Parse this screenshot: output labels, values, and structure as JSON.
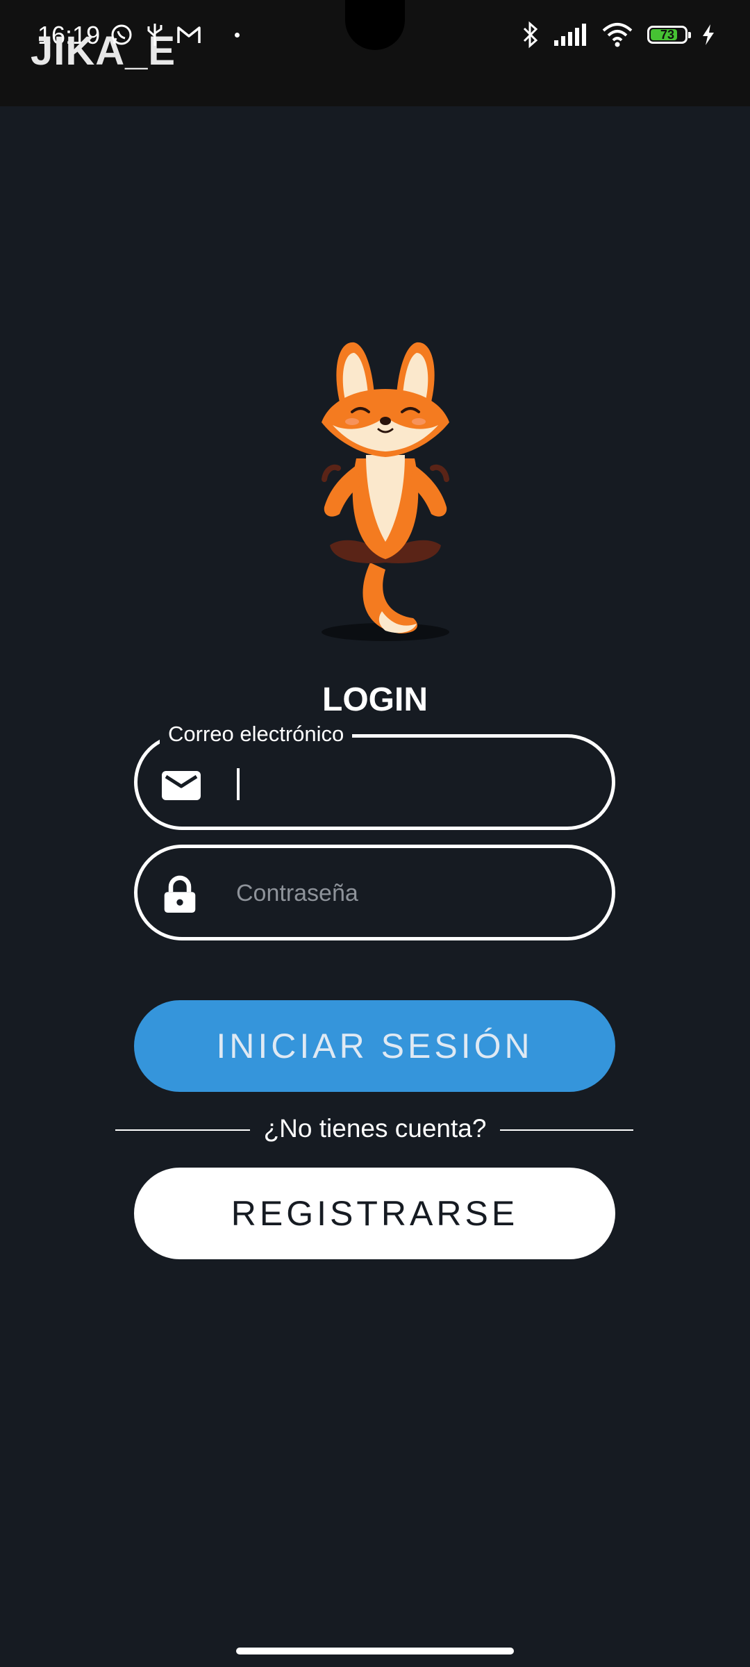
{
  "status_bar": {
    "time": "16:19",
    "app_overlay": "JIKA_E",
    "battery": "73",
    "icons": [
      "whatsapp-icon",
      "usb-icon",
      "gmail-icon",
      "bluetooth-icon",
      "signal-icon",
      "wifi-icon",
      "battery-icon",
      "charging-icon"
    ]
  },
  "login": {
    "title": "LOGIN",
    "email": {
      "label": "Correo electrónico",
      "value": "",
      "icon": "mail-icon"
    },
    "password": {
      "placeholder": "Contraseña",
      "value": "",
      "icon": "lock-icon"
    },
    "submit_label": "INICIAR SESIÓN",
    "no_account_text": "¿No tienes cuenta?",
    "register_label": "REGISTRARSE"
  },
  "colors": {
    "background": "#161b22",
    "primary_button": "#3595db",
    "secondary_button": "#ffffff",
    "battery_fill": "#46c233"
  }
}
